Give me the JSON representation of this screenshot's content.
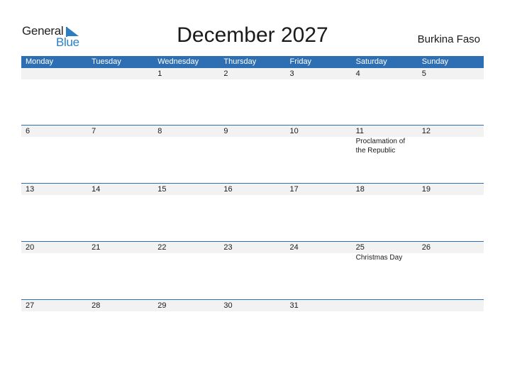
{
  "logo": {
    "general": "General",
    "blue": "Blue",
    "icon": "logo-triangle-icon"
  },
  "title": "December 2027",
  "country": "Burkina Faso",
  "colors": {
    "accent": "#2e6fb3",
    "band": "#f2f2f2",
    "logo_blue": "#2a7fc4"
  },
  "weekdays": [
    "Monday",
    "Tuesday",
    "Wednesday",
    "Thursday",
    "Friday",
    "Saturday",
    "Sunday"
  ],
  "weeks": [
    [
      {
        "day": ""
      },
      {
        "day": ""
      },
      {
        "day": "1"
      },
      {
        "day": "2"
      },
      {
        "day": "3"
      },
      {
        "day": "4"
      },
      {
        "day": "5"
      }
    ],
    [
      {
        "day": "6"
      },
      {
        "day": "7"
      },
      {
        "day": "8"
      },
      {
        "day": "9"
      },
      {
        "day": "10"
      },
      {
        "day": "11",
        "event": "Proclamation of the Republic"
      },
      {
        "day": "12"
      }
    ],
    [
      {
        "day": "13"
      },
      {
        "day": "14"
      },
      {
        "day": "15"
      },
      {
        "day": "16"
      },
      {
        "day": "17"
      },
      {
        "day": "18"
      },
      {
        "day": "19"
      }
    ],
    [
      {
        "day": "20"
      },
      {
        "day": "21"
      },
      {
        "day": "22"
      },
      {
        "day": "23"
      },
      {
        "day": "24"
      },
      {
        "day": "25",
        "event": "Christmas Day"
      },
      {
        "day": "26"
      }
    ],
    [
      {
        "day": "27"
      },
      {
        "day": "28"
      },
      {
        "day": "29"
      },
      {
        "day": "30"
      },
      {
        "day": "31"
      },
      {
        "day": ""
      },
      {
        "day": ""
      }
    ]
  ]
}
